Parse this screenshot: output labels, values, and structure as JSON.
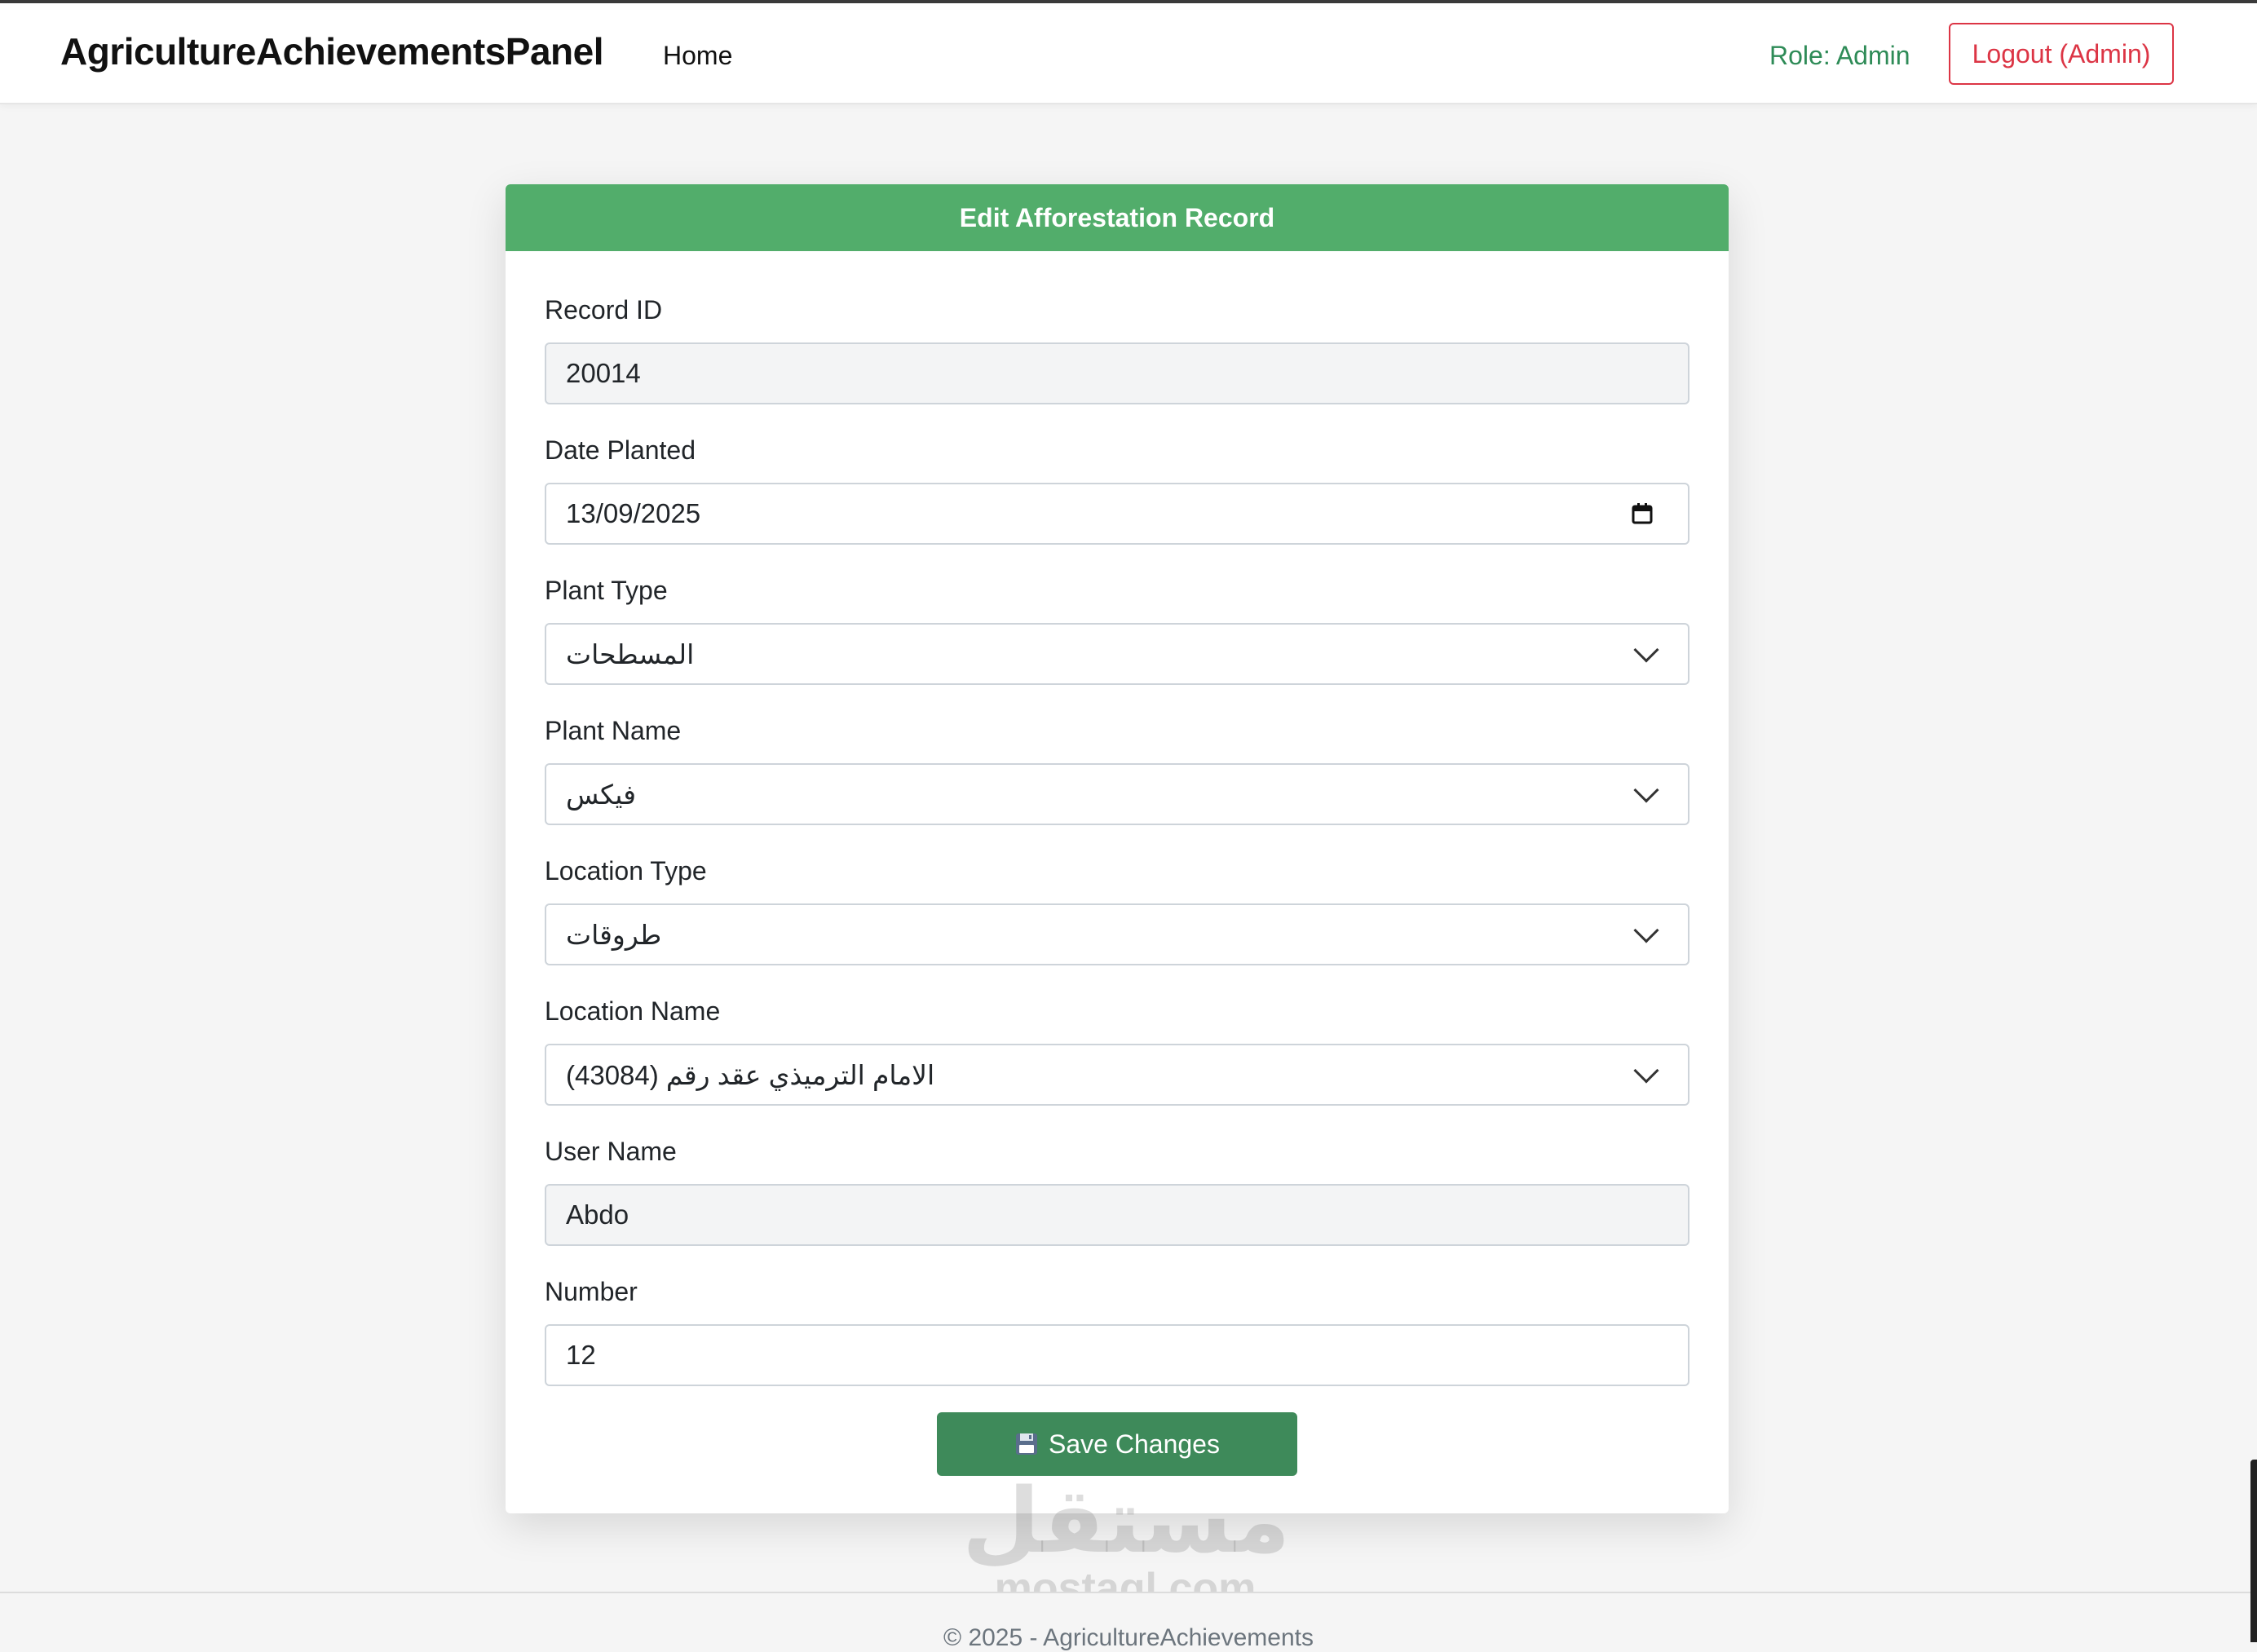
{
  "navbar": {
    "brand": "AgricultureAchievementsPanel",
    "home_link": "Home",
    "role_text": "Role: Admin",
    "logout_label": "Logout (Admin)"
  },
  "form": {
    "title": "Edit Afforestation Record",
    "fields": [
      {
        "label": "Record ID",
        "value": "20014",
        "kind": "text",
        "readonly": true
      },
      {
        "label": "Date Planted",
        "value": "13/09/2025",
        "kind": "date",
        "readonly": false
      },
      {
        "label": "Plant Type",
        "value": "المسطحات",
        "kind": "select",
        "readonly": false
      },
      {
        "label": "Plant Name",
        "value": "فيكس",
        "kind": "select",
        "readonly": false
      },
      {
        "label": "Location Type",
        "value": "طروقات",
        "kind": "select",
        "readonly": false
      },
      {
        "label": "Location Name",
        "value": "الامام الترميذي عقد رقم (43084)",
        "kind": "select",
        "readonly": false
      },
      {
        "label": "User Name",
        "value": "Abdo",
        "kind": "text",
        "readonly": true
      },
      {
        "label": "Number",
        "value": "12",
        "kind": "number",
        "readonly": false
      }
    ],
    "save_label": "Save Changes",
    "save_icon": "floppy-disk-icon"
  },
  "watermark": {
    "arabic": "مستقل",
    "latin": "mostaql.com"
  },
  "footer": {
    "text": "© 2025 - AgricultureAchievements"
  },
  "colors": {
    "header_green": "#52ad6b",
    "button_green": "#3e8a5a",
    "role_green": "#2e8b57",
    "logout_red": "#dc3545"
  }
}
